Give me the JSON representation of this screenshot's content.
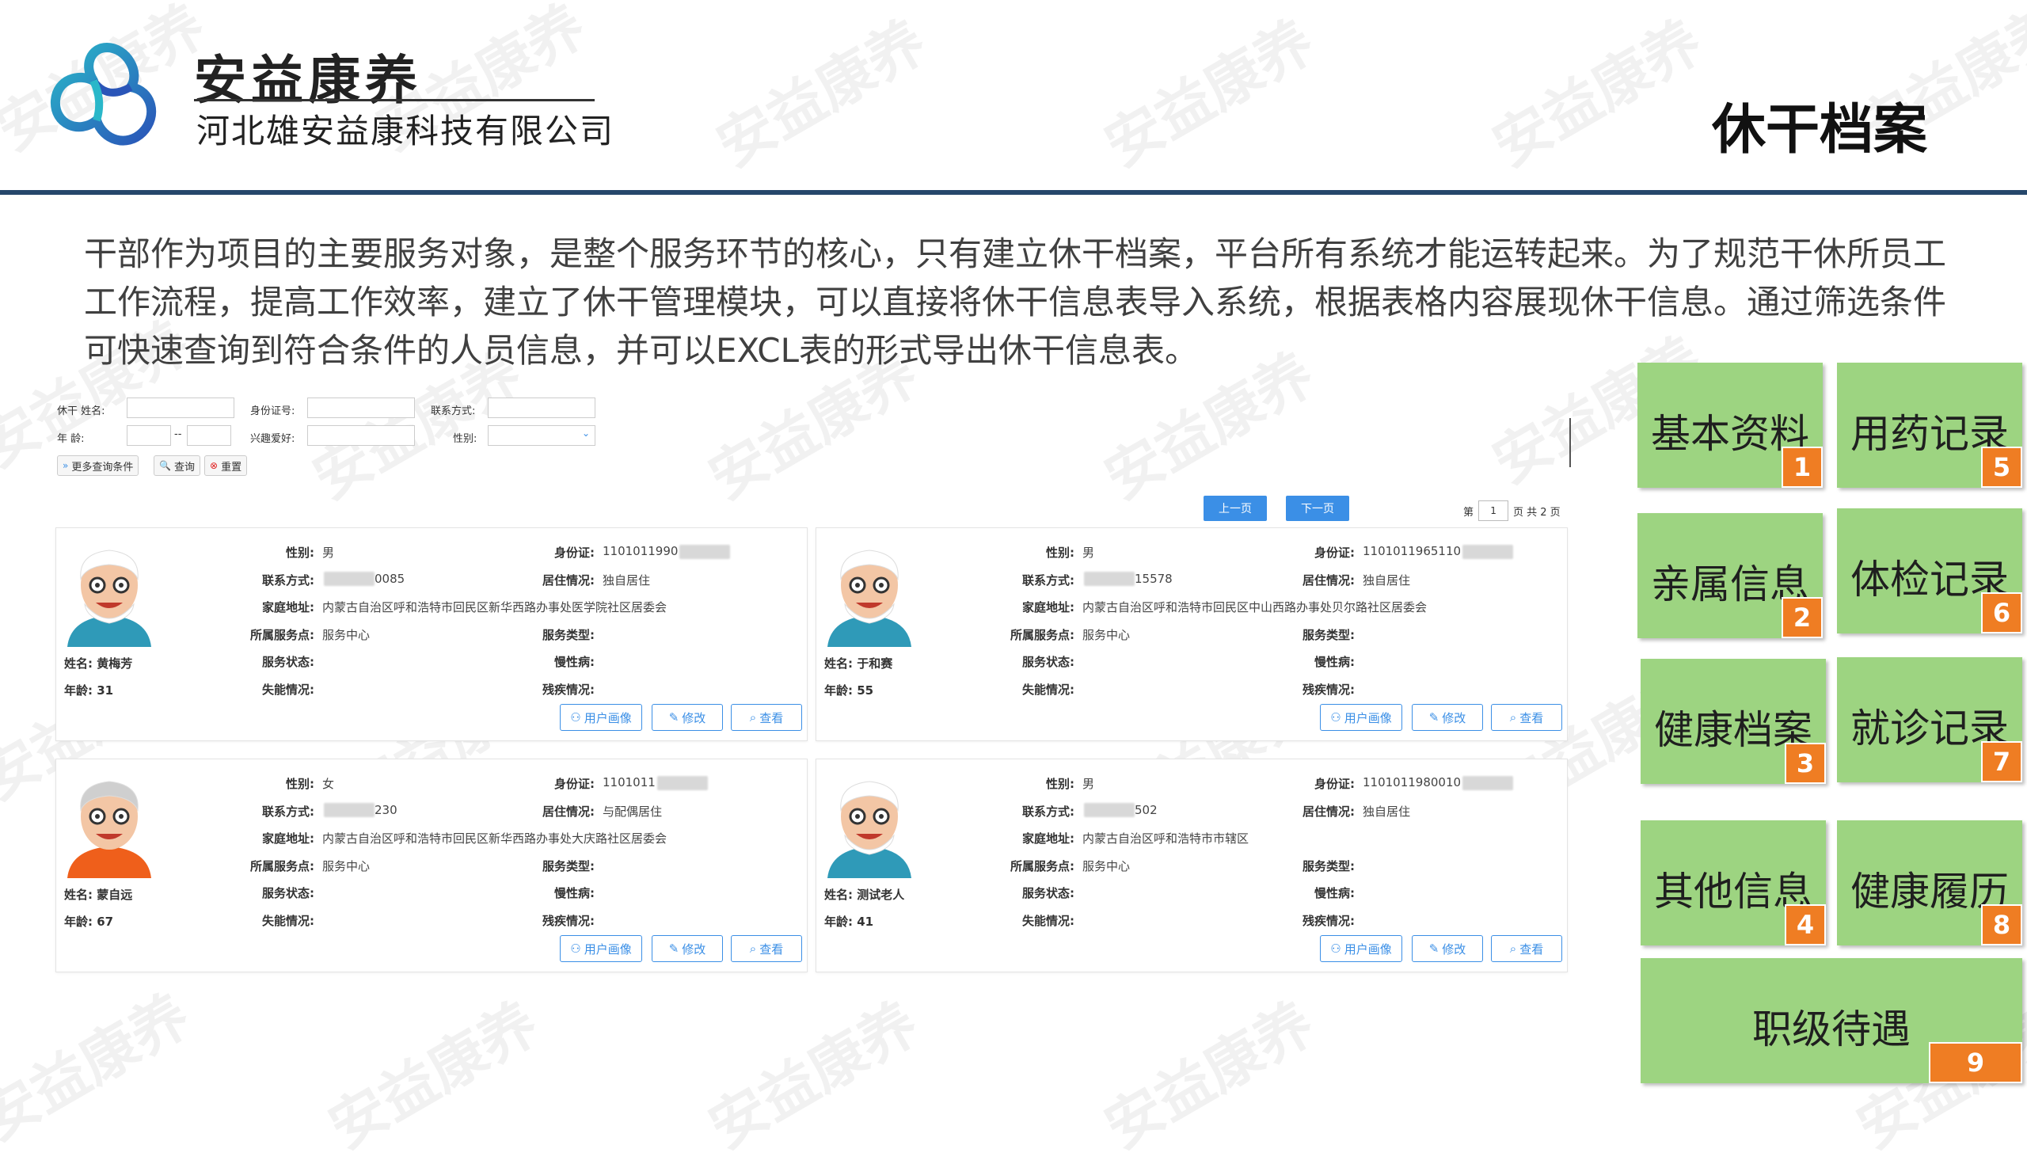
{
  "header": {
    "company_name": "安益康养",
    "company_full": "河北雄安益康科技有限公司",
    "page_title": "休干档案",
    "watermark": "安益康养"
  },
  "intro": "干部作为项目的主要服务对象，是整个服务环节的核心，只有建立休干档案，平台所有系统才能运转起来。为了规范干休所员工工作流程，提高工作效率，建立了休干管理模块，可以直接将休干信息表导入系统，根据表格内容展现休干信息。通过筛选条件可快速查询到符合条件的人员信息，并可以EXCL表的形式导出休干信息表。",
  "search": {
    "name_label": "休干 姓名:",
    "id_label": "身份证号:",
    "contact_label": "联系方式:",
    "age_label": "年  龄:",
    "age_sep": "--",
    "hobby_label": "兴趣爱好:",
    "gender_label": "性别:",
    "more_btn": "更多查询条件",
    "query_btn": "查询",
    "reset_btn": "重置"
  },
  "pager": {
    "prev": "上一页",
    "next": "下一页",
    "page_prefix": "第",
    "page_current": "1",
    "page_suffix": "页 共 2 页"
  },
  "labels": {
    "gender": "性别:",
    "contact": "联系方式:",
    "address": "家庭地址:",
    "service_point": "所属服务点:",
    "service_status": "服务状态:",
    "disability": "失能情况:",
    "id_card": "身份证:",
    "living": "居住情况:",
    "service_type": "服务类型:",
    "chronic": "慢性病:",
    "handicap": "残疾情况:",
    "name_prefix": "姓名:",
    "age_prefix": "年龄:",
    "btn_portrait": "用户画像",
    "btn_edit": "修改",
    "btn_view": "查看"
  },
  "cards": [
    {
      "name": "黄梅芳",
      "age": "31",
      "gender": "男",
      "contact": "0085",
      "address": "内蒙古自治区呼和浩特市回民区新华西路办事处医学院社区居委会",
      "service_point": "服务中心",
      "id_card": "1101011990",
      "living": "独自居住"
    },
    {
      "name": "于和赛",
      "age": "55",
      "gender": "男",
      "contact": "15578",
      "address": "内蒙古自治区呼和浩特市回民区中山西路办事处贝尔路社区居委会",
      "service_point": "服务中心",
      "id_card": "1101011965110",
      "living": "独自居住"
    },
    {
      "name": "蒙自远",
      "age": "67",
      "gender": "女",
      "contact": "230",
      "address": "内蒙古自治区呼和浩特市回民区新华西路办事处大庆路社区居委会",
      "service_point": "服务中心",
      "id_card": "1101011",
      "living": "与配偶居住"
    },
    {
      "name": "测试老人",
      "age": "41",
      "gender": "男",
      "contact": "502",
      "address": "内蒙古自治区呼和浩特市市辖区",
      "service_point": "服务中心",
      "id_card": "1101011980010",
      "living": "独自居住"
    }
  ],
  "tiles": [
    {
      "label": "基本资料",
      "num": "1"
    },
    {
      "label": "亲属信息",
      "num": "2"
    },
    {
      "label": "健康档案",
      "num": "3"
    },
    {
      "label": "其他信息",
      "num": "4"
    },
    {
      "label": "用药记录",
      "num": "5"
    },
    {
      "label": "体检记录",
      "num": "6"
    },
    {
      "label": "就诊记录",
      "num": "7"
    },
    {
      "label": "健康履历",
      "num": "8"
    },
    {
      "label": "职级待遇",
      "num": "9"
    }
  ],
  "colors": {
    "header_line": "#26476b",
    "tile_green": "#9dd481",
    "tile_badge": "#ef7d23",
    "accent_blue": "#3b8fe6"
  }
}
